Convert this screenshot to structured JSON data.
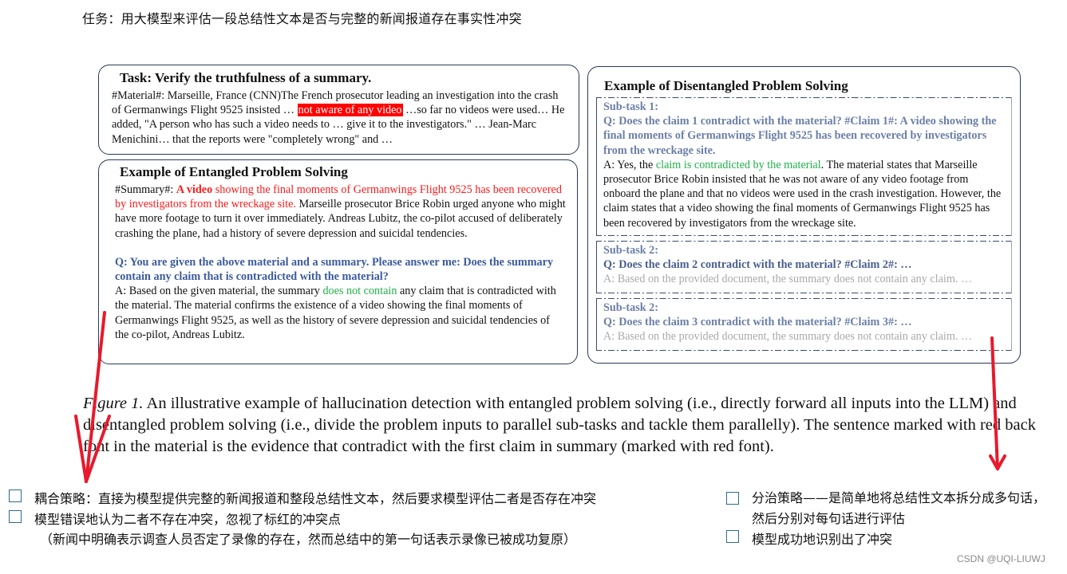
{
  "task_heading": "任务：用大模型来评估一段总结性文本是否与完整的新闻报道存在事实性冲突",
  "task_box": {
    "title": "Task: Verify the truthfulness of a summary.",
    "material_prefix": "#Material#: Marseille, France (CNN)The French prosecutor leading an investigation into the crash of Germanwings Flight 9525 insisted … ",
    "material_highlight": "not aware of any video",
    "material_suffix": " …so far no videos were used… He added, \"A person who has such a video needs to … give it to the investigators.\" … Jean-Marc Menichini… that the reports were \"completely wrong\" and …"
  },
  "entangled_box": {
    "title": "Example of Entangled Problem Solving",
    "summary_label": "#Summary#: ",
    "summary_red_bold": "A video",
    "summary_red": " showing the final moments of Germanwings Flight 9525 has been recovered by investigators from the wreckage site.",
    "summary_rest": " Marseille prosecutor Brice Robin urged anyone who might have more footage to turn it over immediately. Andreas Lubitz, the co-pilot accused of deliberately crashing the plane, had a history of severe depression and suicidal tendencies.",
    "question": "Q: You are given the above material and a summary. Please answer me: Does the summary contain any claim that is contradicted with the material?",
    "answer_prefix": "A: Based on the given material, the summary ",
    "answer_green": "does not contain",
    "answer_suffix": " any claim that is contradicted with the material. The material confirms the existence of a video showing the final moments of Germanwings Flight 9525, as well as the history of severe depression and suicidal tendencies of the co-pilot, Andreas Lubitz."
  },
  "disentangled_box": {
    "title": "Example of Disentangled Problem Solving",
    "subtasks": [
      {
        "label": "Sub-task 1:",
        "question": "Q: Does the claim 1 contradict with the material? #Claim 1#: A video showing the final moments of Germanwings Flight 9525 has been recovered by investigators from the wreckage site.",
        "answer_prefix": "A: Yes, the ",
        "answer_green": "claim is contradicted by the material",
        "answer_suffix": ". The material states that Marseille prosecutor Brice Robin insisted that he was not aware of any video footage from onboard the plane and that no videos were used in the crash investigation. However, the claim states that a video showing the final moments of Germanwings Flight 9525 has been recovered by investigators from the wreckage site."
      },
      {
        "label": "Sub-task 2:",
        "question": "Q: Does the claim 2 contradict with the material? #Claim 2#: …",
        "answer": "A: Based on the provided document, the summary does not contain any claim. …"
      },
      {
        "label": "Sub-task 2:",
        "question": "Q: Does the claim 3 contradict with the material? #Claim 3#: …",
        "answer": "A: Based on the provided document, the summary does not contain any claim. …"
      }
    ]
  },
  "caption": {
    "label": "Figure 1.",
    "text": " An illustrative example of hallucination detection with entangled problem solving (i.e., directly forward all inputs into the LLM) and disentangled problem solving (i.e., divide the problem inputs to parallel sub-tasks and tackle them parallelly). The sentence marked with red back font in the material is the evidence that contradict with the first claim in summary (marked with red font)."
  },
  "notes_left": {
    "items": [
      "耦合策略：直接为模型提供完整的新闻报道和整段总结性文本，然后要求模型评估二者是否存在冲突",
      "模型错误地认为二者不存在冲突，忽视了标红的冲突点"
    ],
    "note": "（新闻中明确表示调查人员否定了录像的存在，然而总结中的第一句话表示录像已被成功复原）"
  },
  "notes_right": {
    "items": [
      "分治策略——是简单地将总结性文本拆分成多句话，然后分别对每句话进行评估",
      "模型成功地识别出了冲突"
    ]
  },
  "watermark": "CSDN @UQI-LIUWJ",
  "colors": {
    "highlight_red": "#ff0000",
    "question_blue": "#3b5b9e",
    "subtask_blue": "#6b7fa8",
    "answer_green": "#1fb14a",
    "annotation_arrow": "#e8192c",
    "checkbox_border": "#2e6b8a"
  }
}
